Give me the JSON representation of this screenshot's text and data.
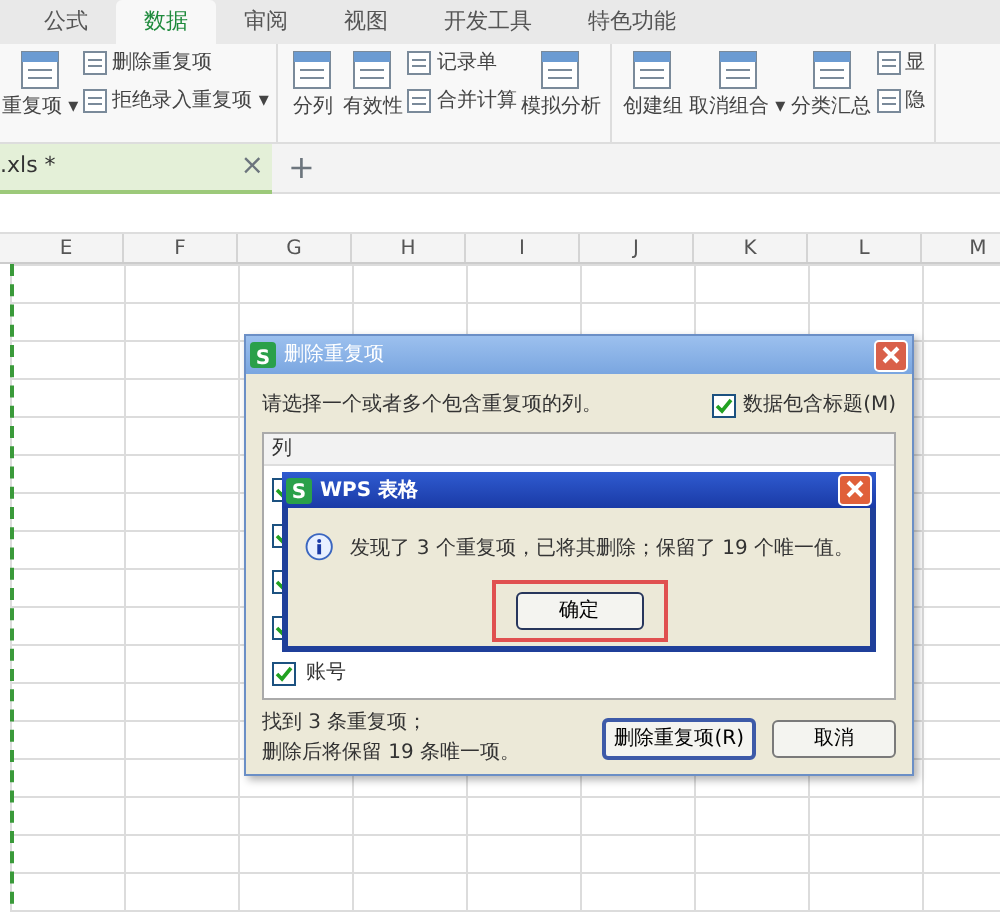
{
  "ribbon_tabs": [
    {
      "label": "公式",
      "selected": false
    },
    {
      "label": "数据",
      "selected": true
    },
    {
      "label": "审阅",
      "selected": false
    },
    {
      "label": "视图",
      "selected": false
    },
    {
      "label": "开发工具",
      "selected": false
    },
    {
      "label": "特色功能",
      "selected": false
    }
  ],
  "ribbon_groups": [
    [
      {
        "kind": "large",
        "label": "重复项 ▾"
      },
      {
        "kind": "stack",
        "items": [
          "删除重复项",
          "拒绝录入重复项 ▾"
        ]
      }
    ],
    [
      {
        "kind": "large",
        "label": "分列"
      },
      {
        "kind": "large",
        "label": "有效性"
      },
      {
        "kind": "stack",
        "items": [
          "记录单",
          "合并计算"
        ]
      },
      {
        "kind": "large",
        "label": "模拟分析"
      }
    ],
    [
      {
        "kind": "large",
        "label": "创建组"
      },
      {
        "kind": "large",
        "label": "取消组合 ▾"
      },
      {
        "kind": "large",
        "label": "分类汇总"
      },
      {
        "kind": "stack",
        "items": [
          "显",
          "隐"
        ]
      }
    ]
  ],
  "file_tab": {
    "name": ".xls *",
    "close": "×",
    "new_tab": "+"
  },
  "columns": [
    "E",
    "F",
    "G",
    "H",
    "I",
    "J",
    "K",
    "L",
    "M"
  ],
  "dialog": {
    "app_mark": "S",
    "title": "删除重复项",
    "prompt": "请选择一个或者多个包含重复项的列。",
    "header_checkbox": {
      "label": "数据包含标题(M)",
      "checked": true
    },
    "list_header": "列",
    "items": [
      {
        "checked": true
      },
      {
        "checked": true
      },
      {
        "checked": true
      },
      {
        "checked": true
      },
      {
        "label": "账号",
        "checked": true
      }
    ],
    "summary": [
      "找到 3 条重复项；",
      "删除后将保留 19 条唯一项。"
    ],
    "buttons": [
      {
        "label": "删除重复项(R)",
        "focused": true
      },
      {
        "label": "取消",
        "focused": false
      }
    ]
  },
  "message_box": {
    "app_mark": "S",
    "title": "WPS 表格",
    "message": "发现了 3 个重复项，已将其删除；保留了 19 个唯一值。",
    "button": "确定",
    "highlighted": true
  }
}
